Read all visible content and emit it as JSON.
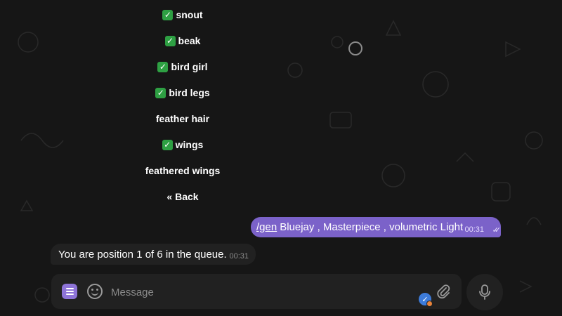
{
  "keyboard": {
    "buttons": [
      {
        "label": "snout",
        "checked": true
      },
      {
        "label": "beak",
        "checked": true
      },
      {
        "label": "bird girl",
        "checked": true
      },
      {
        "label": "bird legs",
        "checked": true
      },
      {
        "label": "feather hair",
        "checked": false
      },
      {
        "label": "wings",
        "checked": true
      },
      {
        "label": "feathered wings",
        "checked": false
      },
      {
        "label": "« Back",
        "checked": false
      }
    ]
  },
  "outgoing_message": {
    "command": "/gen",
    "text": "Bluejay , Masterpiece , volumetric Light",
    "time": "00:31",
    "status": "read"
  },
  "incoming_message": {
    "text": "You are position 1 of 6 in the queue.",
    "time": "00:31"
  },
  "composer": {
    "placeholder": "Message"
  },
  "colors": {
    "background": "#161616",
    "outgoing_bubble": "#7b62c9",
    "incoming_bubble": "#212121",
    "check_green": "#2ea043"
  }
}
